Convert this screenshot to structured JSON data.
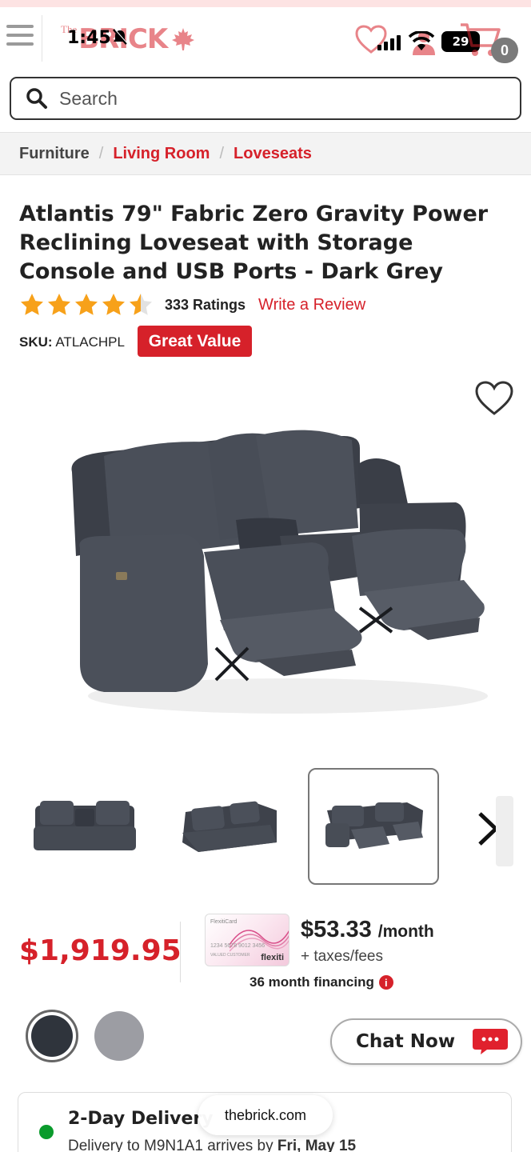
{
  "status_bar": {
    "time": "1:45",
    "battery": "29"
  },
  "header": {
    "logo_the": "The",
    "logo_brick": "BRICK",
    "cart_count": "0"
  },
  "search": {
    "placeholder": "Search"
  },
  "breadcrumb": {
    "items": [
      "Furniture",
      "Living Room",
      "Loveseats"
    ],
    "separator": "/"
  },
  "product": {
    "title": "Atlantis 79\" Fabric Zero Gravity Power Reclining Loveseat with Storage Console and USB Ports - Dark Grey",
    "rating": 4.5,
    "rating_count": "333 Ratings",
    "write_review": "Write a Review",
    "sku_label": "SKU:",
    "sku_value": "ATLACHPL",
    "badge": "Great Value"
  },
  "pricing": {
    "price": "$1,919.95",
    "monthly_amount": "$53.33",
    "monthly_unit": "/month",
    "taxes": "+ taxes/fees",
    "financing": "36 month financing",
    "card_label": "FlexitiCard",
    "card_brand": "flexiti",
    "card_number": "1234 5678 9012 3456",
    "card_holder": "VALUED CUSTOMER"
  },
  "swatches": [
    {
      "name": "Dark Grey",
      "color": "#2f343c",
      "selected": true
    },
    {
      "name": "Light Grey",
      "color": "#9c9da3",
      "selected": false
    }
  ],
  "chat": {
    "label": "Chat Now"
  },
  "delivery": {
    "title": "2-Day Delivery",
    "text_prefix": "Delivery to M9N1A1 arrives by ",
    "date": "Fri, May 15"
  },
  "browser": {
    "url": "thebrick.com"
  },
  "colors": {
    "brand_red": "#d6212a",
    "star_orange": "#f7a11a",
    "in_stock_green": "#0a9b2c"
  },
  "icons": [
    "menu-icon",
    "maple-leaf-icon",
    "heart-icon",
    "account-icon",
    "cart-icon",
    "search-icon",
    "star-icon",
    "chevron-right-icon",
    "info-icon",
    "chat-bubble-icon"
  ]
}
